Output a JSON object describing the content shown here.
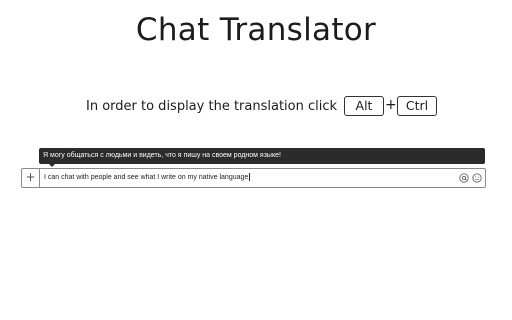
{
  "header": {
    "title": "Chat Translator"
  },
  "hint": {
    "text": "In order to display the translation click",
    "key1": "Alt",
    "separator": "+",
    "key2": "Ctrl"
  },
  "tooltip": {
    "translation": "Я могу общаться с людьми и видеть, что я пишу на своем родном языке!"
  },
  "composer": {
    "add_label": "+",
    "message": "I can chat with people and see what I write on my native language",
    "icons": [
      "at-icon",
      "emoji-icon"
    ]
  }
}
